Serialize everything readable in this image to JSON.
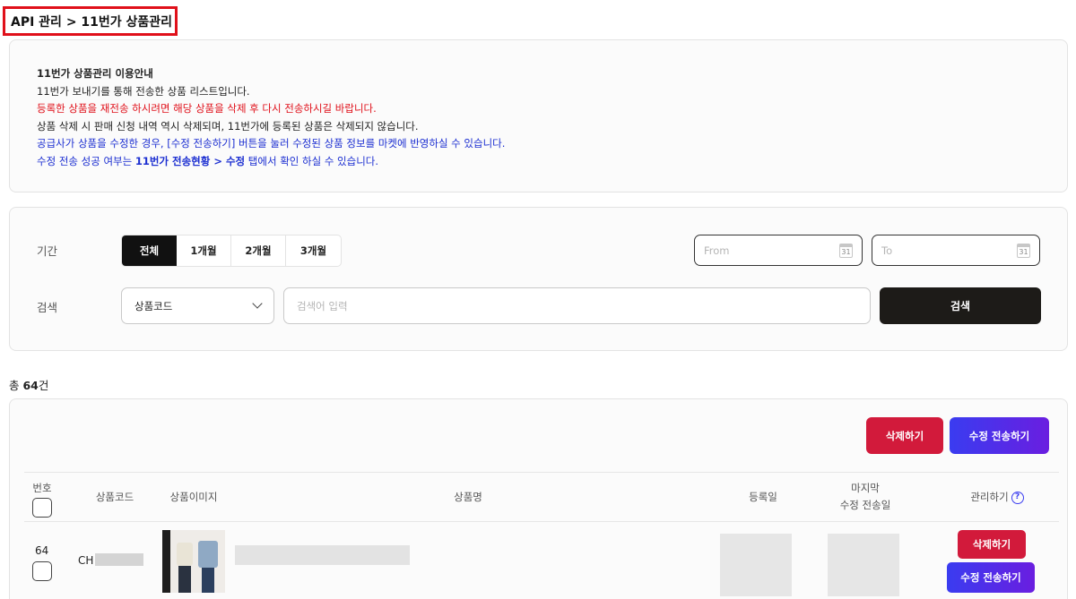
{
  "breadcrumb": "API 관리 > 11번가 상품관리",
  "notice": {
    "title": "11번가 상품관리 이용안내",
    "line1": "11번가 보내기를 통해 전송한 상품 리스트입니다.",
    "line2": "등록한 상품을 재전송 하시려면 해당 상품을 삭제 후 다시 전송하시길 바랍니다.",
    "line3": "상품 삭제 시 판매 신청 내역 역시 삭제되며, 11번가에 등록된 상품은 삭제되지 않습니다.",
    "line4": "공급사가 상품을 수정한 경우, [수정 전송하기] 버튼을 눌러 수정된 상품 정보를 마켓에 반영하실 수 있습니다.",
    "line5_prefix": "수정 전송 성공 여부는 ",
    "line5_bold": "11번가 전송현황 > 수정",
    "line5_suffix": " 탭에서 확인 하실 수 있습니다."
  },
  "filter": {
    "period_label": "기간",
    "period_options": [
      "전체",
      "1개월",
      "2개월",
      "3개월"
    ],
    "from_placeholder": "From",
    "to_placeholder": "To",
    "calendar_day": "31",
    "search_label": "검색",
    "search_type": "상품코드",
    "search_placeholder": "검색어 입력",
    "search_button": "검색"
  },
  "total": {
    "prefix": "총 ",
    "count": "64",
    "suffix": "건"
  },
  "actions": {
    "delete": "삭제하기",
    "resend": "수정 전송하기"
  },
  "table": {
    "headers": {
      "no": "번호",
      "code": "상품코드",
      "image": "상품이미지",
      "name": "상품명",
      "registered": "등록일",
      "last_sent_1": "마지막",
      "last_sent_2": "수정 전송일",
      "manage": "관리하기",
      "help": "?"
    },
    "rows": [
      {
        "no": "64",
        "code_prefix": "CH",
        "delete": "삭제하기",
        "resend": "수정 전송하기"
      }
    ]
  },
  "colors": {
    "accent_red": "#d21a3b",
    "accent_blue": "#3a3cf0",
    "highlight": "#e0101a",
    "info_blue": "#1c2fd1"
  }
}
